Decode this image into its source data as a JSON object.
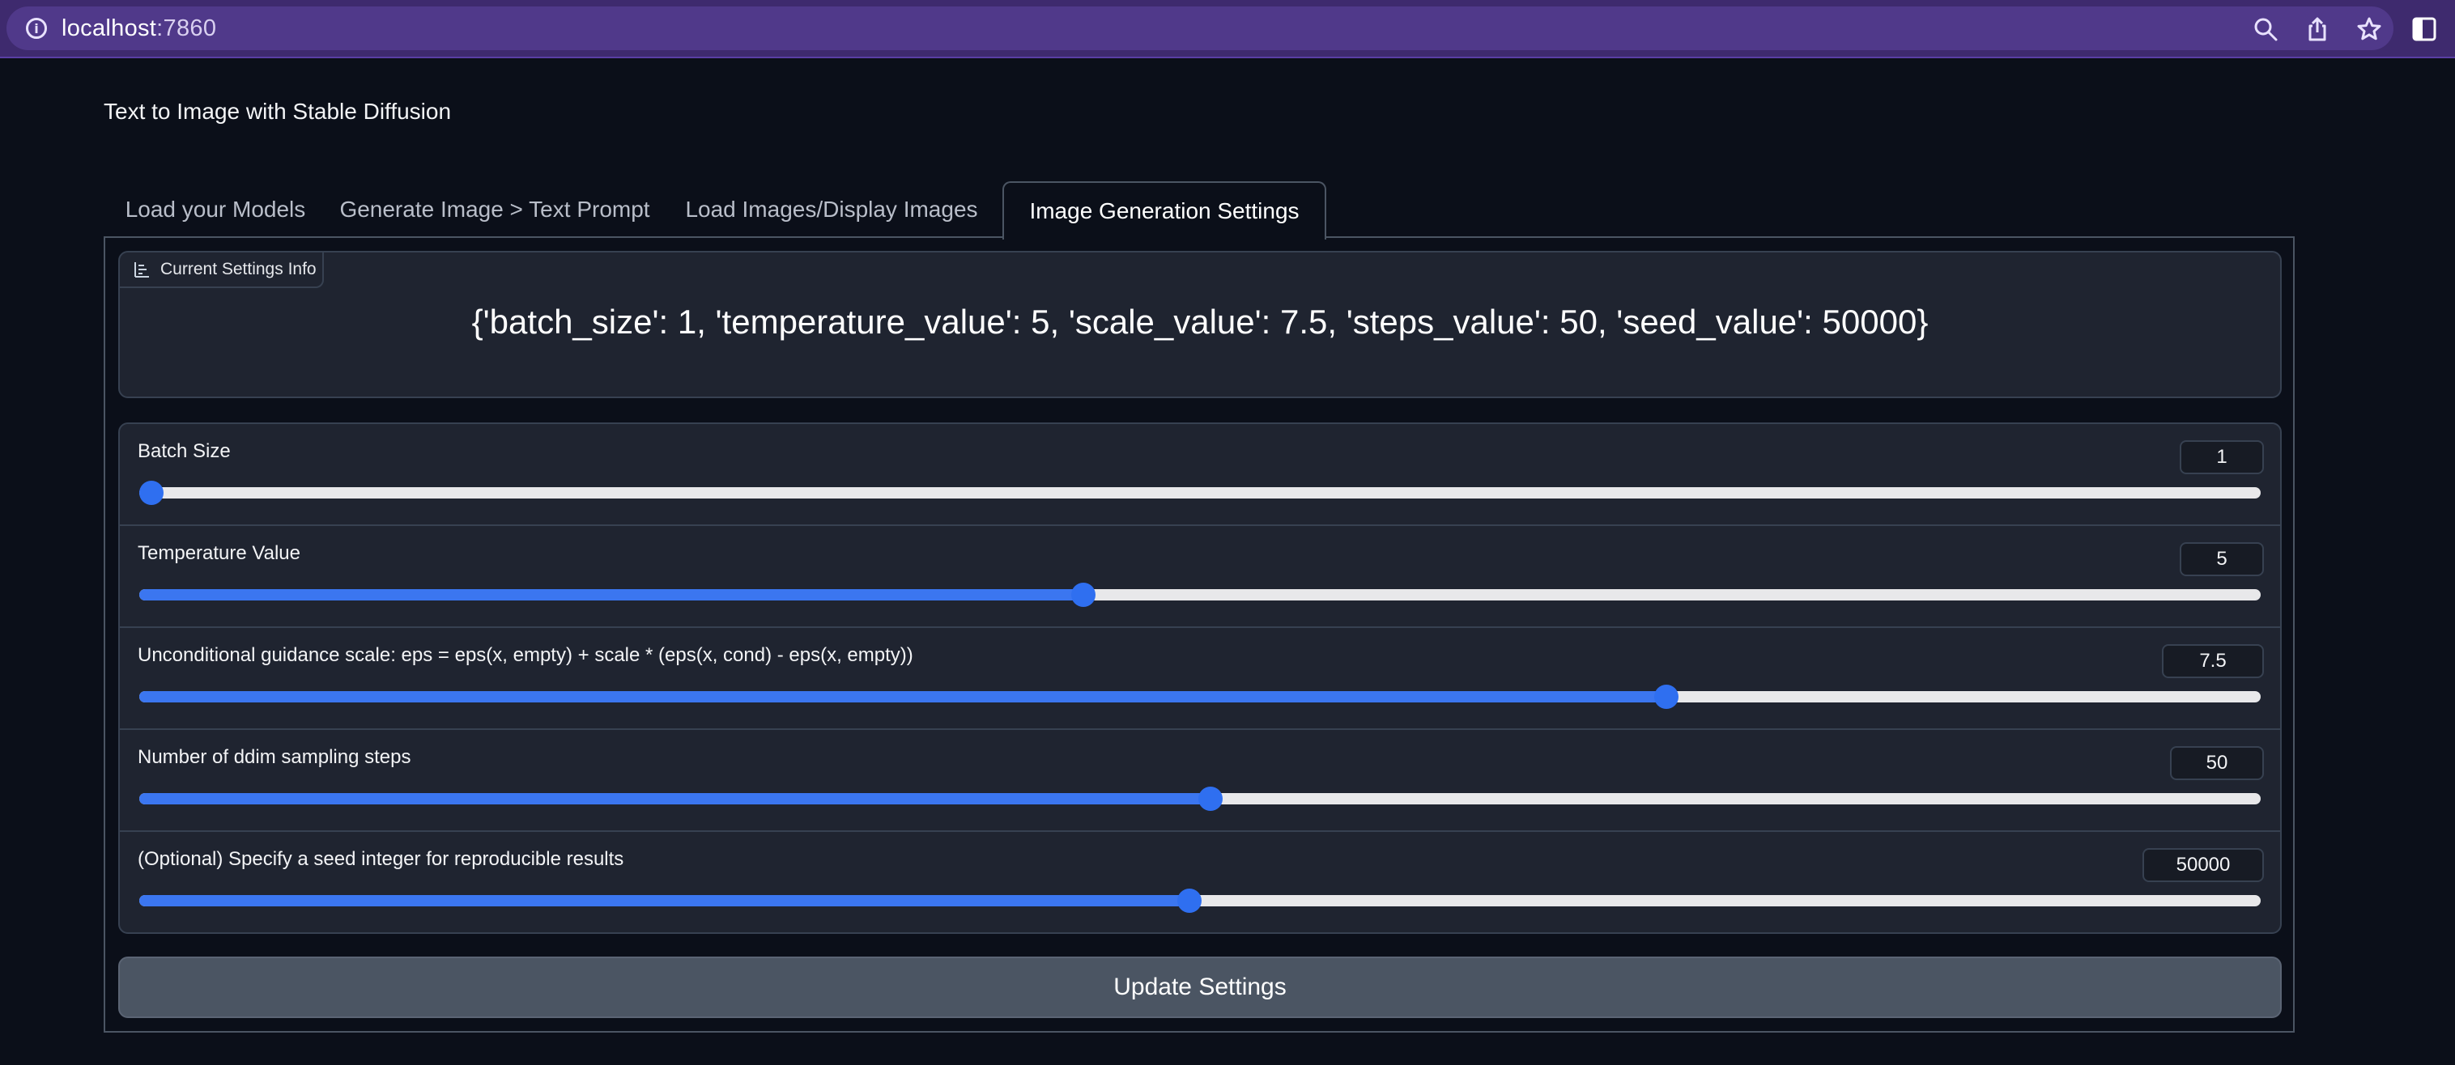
{
  "browser": {
    "url_host": "localhost",
    "url_port": ":7860"
  },
  "app": {
    "title": "Text to Image with Stable Diffusion"
  },
  "tabs": [
    {
      "label": "Load your Models",
      "active": false
    },
    {
      "label": "Generate Image > Text Prompt",
      "active": false
    },
    {
      "label": "Load Images/Display Images",
      "active": false
    },
    {
      "label": "Image Generation Settings",
      "active": true
    }
  ],
  "settings_info": {
    "label": "Current Settings Info",
    "value": "{'batch_size': 1, 'temperature_value': 5, 'scale_value': 7.5, 'steps_value': 50, 'seed_value': 50000}"
  },
  "sliders": [
    {
      "label": "Batch Size",
      "value": "1",
      "fraction": 0.0
    },
    {
      "label": "Temperature Value",
      "value": "5",
      "fraction": 0.445
    },
    {
      "label": "Unconditional guidance scale: eps = eps(x, empty) + scale * (eps(x, cond) - eps(x, empty))",
      "value": "7.5",
      "fraction": 0.72
    },
    {
      "label": "Number of ddim sampling steps",
      "value": "50",
      "fraction": 0.505
    },
    {
      "label": "(Optional) Specify a seed integer for reproducible results",
      "value": "50000",
      "fraction": 0.495
    }
  ],
  "update_button": {
    "label": "Update Settings"
  },
  "colors": {
    "accent": "#3b76f0",
    "background": "#0b0f19",
    "browser_bar": "#3e2a6e"
  }
}
